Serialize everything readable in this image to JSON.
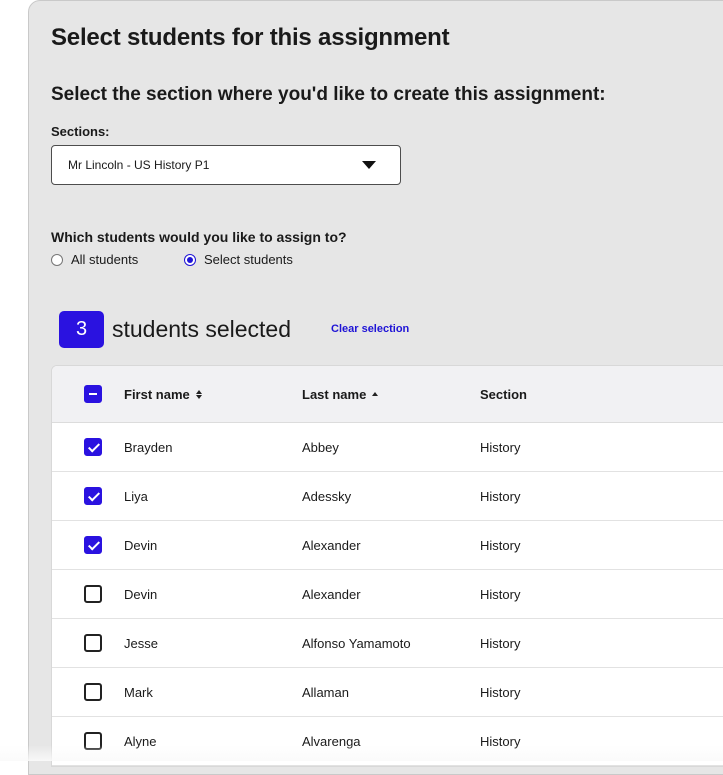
{
  "dialog": {
    "title": "Select students for this assignment",
    "subtitle": "Select the section where you'd like to create this assignment:",
    "sections_label": "Sections:",
    "sections_value": "Mr Lincoln - US History P1",
    "question": "Which students would you like to assign to?",
    "radio_all": "All students",
    "radio_select": "Select students",
    "radio_selected": "Select students"
  },
  "selection": {
    "count": "3",
    "count_text": "students selected",
    "clear_label": "Clear selection"
  },
  "table": {
    "headers": {
      "first": "First name",
      "last": "Last name",
      "section": "Section"
    },
    "rows": [
      {
        "first": "Brayden",
        "last": "Abbey",
        "section": "History",
        "checked": true
      },
      {
        "first": "Liya",
        "last": "Adessky",
        "section": "History",
        "checked": true
      },
      {
        "first": "Devin",
        "last": "Alexander",
        "section": "History",
        "checked": true
      },
      {
        "first": "Devin",
        "last": "Alexander",
        "section": "History",
        "checked": false
      },
      {
        "first": "Jesse",
        "last": "Alfonso Yamamoto",
        "section": "History",
        "checked": false
      },
      {
        "first": "Mark",
        "last": "Allaman",
        "section": "History",
        "checked": false
      },
      {
        "first": "Alyne",
        "last": "Alvarenga",
        "section": "History",
        "checked": false
      }
    ]
  },
  "colors": {
    "accent": "#2a12e0",
    "panel": "#e6e6e6"
  }
}
